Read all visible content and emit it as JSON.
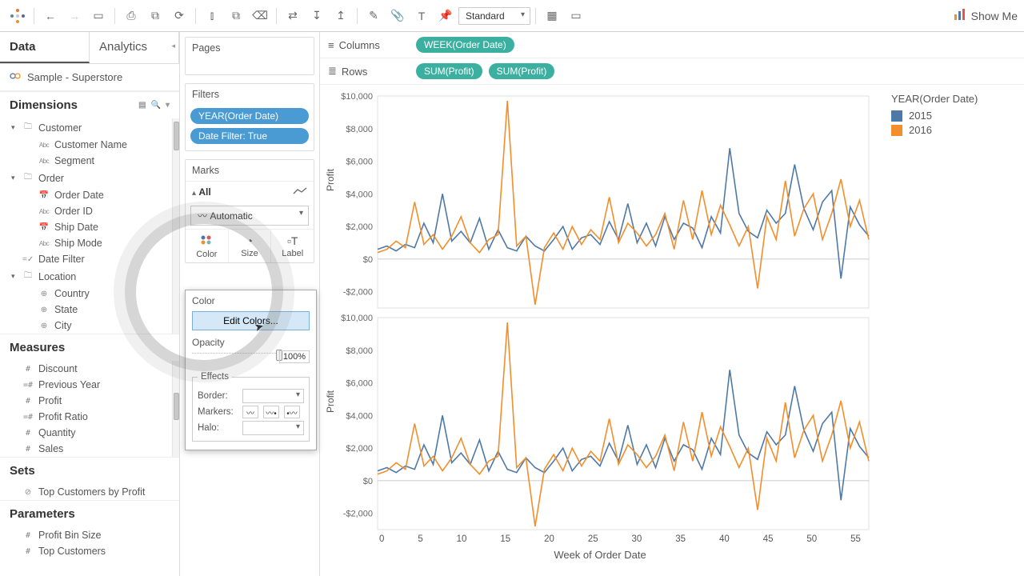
{
  "toolbar": {
    "fit_select": "Standard",
    "showme": "Show Me"
  },
  "side": {
    "tab_data": "Data",
    "tab_analytics": "Analytics",
    "datasource": "Sample - Superstore",
    "dimensions_h": "Dimensions",
    "measures_h": "Measures",
    "sets_h": "Sets",
    "parameters_h": "Parameters",
    "dims": {
      "customer": "Customer",
      "customer_name": "Customer Name",
      "segment": "Segment",
      "order": "Order",
      "order_date": "Order Date",
      "order_id": "Order ID",
      "ship_date": "Ship Date",
      "ship_mode": "Ship Mode",
      "date_filter": "Date Filter",
      "location": "Location",
      "country": "Country",
      "state": "State",
      "city": "City"
    },
    "meas": {
      "discount": "Discount",
      "prev_year": "Previous Year",
      "profit": "Profit",
      "profit_ratio": "Profit Ratio",
      "quantity": "Quantity",
      "sales": "Sales"
    },
    "sets": {
      "top_cust_profit": "Top Customers by Profit"
    },
    "params": {
      "profit_bin": "Profit Bin Size",
      "top_cust": "Top Customers"
    }
  },
  "shelves": {
    "pages_h": "Pages",
    "filters_h": "Filters",
    "filter_year": "YEAR(Order Date)",
    "filter_date": "Date Filter: True",
    "marks_h": "Marks",
    "marks_all": "All",
    "mark_type": "Automatic",
    "color": "Color",
    "size": "Size",
    "label": "Label"
  },
  "popup": {
    "color_h": "Color",
    "edit_colors": "Edit Colors...",
    "opacity_h": "Opacity",
    "opacity_val": "100%",
    "effects_h": "Effects",
    "border": "Border:",
    "markers": "Markers:",
    "halo": "Halo:"
  },
  "crs": {
    "columns_h": "Columns",
    "rows_h": "Rows",
    "col_pill": "WEEK(Order Date)",
    "row_pill1": "SUM(Profit)",
    "row_pill2": "SUM(Profit)"
  },
  "legend": {
    "title": "YEAR(Order Date)",
    "i1": "2015",
    "i2": "2016"
  },
  "axes": {
    "ylabel": "Profit",
    "xlabel": "Week of Order Date",
    "yticks": [
      "$10,000",
      "$8,000",
      "$6,000",
      "$4,000",
      "$2,000",
      "$0",
      "-$2,000"
    ],
    "xticks": [
      "0",
      "5",
      "10",
      "15",
      "20",
      "25",
      "30",
      "35",
      "40",
      "45",
      "50",
      "55"
    ]
  },
  "colors": {
    "s2015": "#4e79a7",
    "s2016": "#f28e2b"
  },
  "chart_data": [
    {
      "type": "line",
      "title": "Profit by Week (top pane)",
      "xlabel": "Week of Order Date",
      "ylabel": "Profit",
      "ylim": [
        -3000,
        10000
      ],
      "x": [
        0,
        1,
        2,
        3,
        4,
        5,
        6,
        7,
        8,
        9,
        10,
        11,
        12,
        13,
        14,
        15,
        16,
        17,
        18,
        19,
        20,
        21,
        22,
        23,
        24,
        25,
        26,
        27,
        28,
        29,
        30,
        31,
        32,
        33,
        34,
        35,
        36,
        37,
        38,
        39,
        40,
        41,
        42,
        43,
        44,
        45,
        46,
        47,
        48,
        49,
        50,
        51,
        52,
        53
      ],
      "series": [
        {
          "name": "2015",
          "color": "#4e79a7",
          "values": [
            600,
            800,
            500,
            900,
            700,
            2200,
            1000,
            4000,
            1100,
            1700,
            1000,
            2500,
            600,
            1800,
            700,
            500,
            1400,
            800,
            500,
            1200,
            2000,
            600,
            1300,
            1500,
            900,
            2300,
            1200,
            3400,
            1000,
            2200,
            800,
            2600,
            1200,
            2200,
            1900,
            700,
            2600,
            1600,
            6800,
            2800,
            1700,
            1300,
            3000,
            2200,
            2800,
            5800,
            3100,
            1800,
            3500,
            4200,
            -1200,
            3200,
            2100,
            1400
          ]
        },
        {
          "name": "2016",
          "color": "#f28e2b",
          "values": [
            400,
            600,
            1100,
            700,
            3500,
            900,
            1500,
            600,
            1400,
            2600,
            1000,
            400,
            1200,
            1500,
            9700,
            800,
            1400,
            -2800,
            700,
            1600,
            600,
            2000,
            900,
            1800,
            1200,
            3800,
            1000,
            2200,
            1600,
            800,
            1500,
            2800,
            600,
            3600,
            1200,
            4200,
            1500,
            3300,
            2100,
            800,
            2000,
            -1800,
            2600,
            1200,
            4800,
            1400,
            3100,
            4000,
            1200,
            2800,
            4900,
            2000,
            3600,
            1200
          ]
        }
      ]
    },
    {
      "type": "line",
      "title": "Profit by Week (bottom pane, duplicate)",
      "xlabel": "Week of Order Date",
      "ylabel": "Profit",
      "ylim": [
        -3000,
        10000
      ],
      "x": [
        0,
        1,
        2,
        3,
        4,
        5,
        6,
        7,
        8,
        9,
        10,
        11,
        12,
        13,
        14,
        15,
        16,
        17,
        18,
        19,
        20,
        21,
        22,
        23,
        24,
        25,
        26,
        27,
        28,
        29,
        30,
        31,
        32,
        33,
        34,
        35,
        36,
        37,
        38,
        39,
        40,
        41,
        42,
        43,
        44,
        45,
        46,
        47,
        48,
        49,
        50,
        51,
        52,
        53
      ],
      "series": [
        {
          "name": "2015",
          "color": "#4e79a7",
          "values": [
            600,
            800,
            500,
            900,
            700,
            2200,
            1000,
            4000,
            1100,
            1700,
            1000,
            2500,
            600,
            1800,
            700,
            500,
            1400,
            800,
            500,
            1200,
            2000,
            600,
            1300,
            1500,
            900,
            2300,
            1200,
            3400,
            1000,
            2200,
            800,
            2600,
            1200,
            2200,
            1900,
            700,
            2600,
            1600,
            6800,
            2800,
            1700,
            1300,
            3000,
            2200,
            2800,
            5800,
            3100,
            1800,
            3500,
            4200,
            -1200,
            3200,
            2100,
            1400
          ]
        },
        {
          "name": "2016",
          "color": "#f28e2b",
          "values": [
            400,
            600,
            1100,
            700,
            3500,
            900,
            1500,
            600,
            1400,
            2600,
            1000,
            400,
            1200,
            1500,
            9700,
            800,
            1400,
            -2800,
            700,
            1600,
            600,
            2000,
            900,
            1800,
            1200,
            3800,
            1000,
            2200,
            1600,
            800,
            1500,
            2800,
            600,
            3600,
            1200,
            4200,
            1500,
            3300,
            2100,
            800,
            2000,
            -1800,
            2600,
            1200,
            4800,
            1400,
            3100,
            4000,
            1200,
            2800,
            4900,
            2000,
            3600,
            1200
          ]
        }
      ]
    }
  ]
}
